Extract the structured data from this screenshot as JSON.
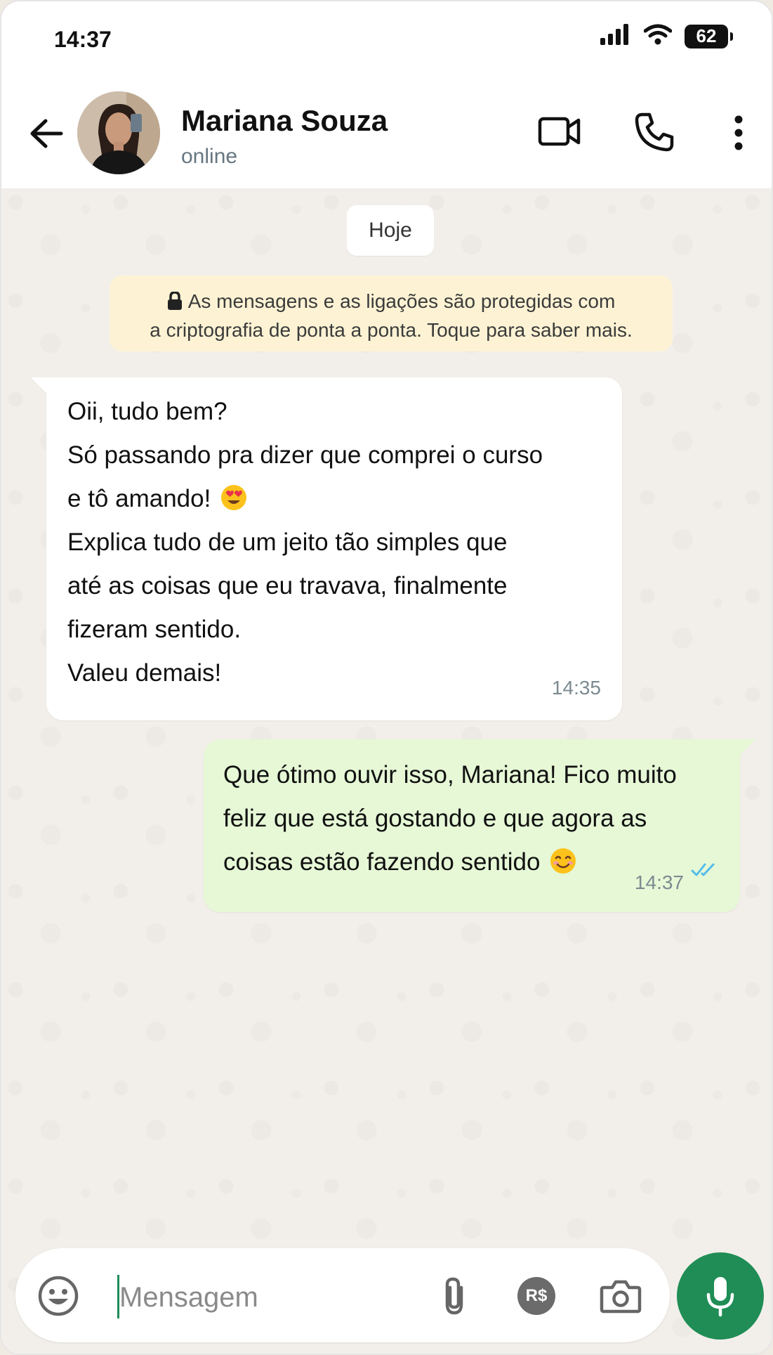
{
  "status_bar": {
    "time": "14:37",
    "battery": "62"
  },
  "header": {
    "contact_name": "Mariana Souza",
    "contact_status": "online",
    "icons": [
      "back-arrow-icon",
      "video-call-icon",
      "phone-icon",
      "more-vertical-icon"
    ]
  },
  "chat": {
    "date_label": "Hoje",
    "encryption_notice": {
      "line1": "As mensagens e as ligações são protegidas com",
      "line2": "a criptografia de ponta a ponta. Toque para saber mais."
    },
    "messages": [
      {
        "direction": "incoming",
        "lines": [
          "Oii, tudo bem?",
          "Só passando pra dizer que comprei o curso",
          "e tô amando!",
          "Explica tudo de um jeito tão simples que",
          "até as coisas que eu travava, finalmente",
          "fizeram sentido.",
          "Valeu demais!"
        ],
        "emoji": "heart-eyes-emoji",
        "time": "14:35"
      },
      {
        "direction": "outgoing",
        "lines": [
          "Que ótimo ouvir isso, Mariana! Fico muito",
          "feliz que está gostando e que agora as",
          "coisas estão fazendo sentido"
        ],
        "emoji": "smiling-emoji",
        "time": "14:37",
        "read_status": "double-check-read"
      }
    ]
  },
  "composer": {
    "placeholder": "Mensagem",
    "value": "",
    "payment_label": "R$"
  },
  "colors": {
    "accent_green": "#1f8d55",
    "outgoing_bubble": "#e6f8d6",
    "read_tick": "#53bdeb",
    "notice_bg": "#fdf3d4"
  }
}
